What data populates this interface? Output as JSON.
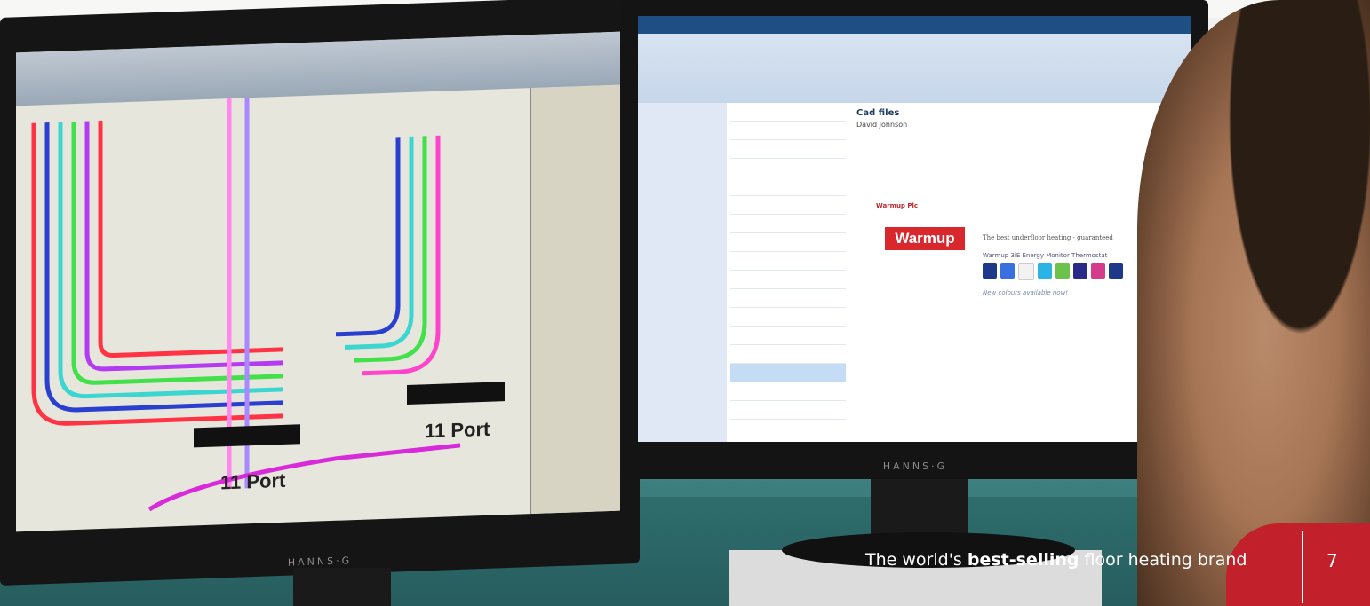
{
  "left_screen": {
    "port_label_left": "11 Port",
    "port_label_right": "11 Port"
  },
  "right_screen": {
    "email_subject": "Cad files",
    "sender": "David Johnson",
    "company": "Warmup Plc",
    "logo_text": "Warmup",
    "tagline": "The best underfloor heating - guaranteed",
    "product": "Warmup 3iE Energy Monitor Thermostat",
    "colours_note": "New colours available now!"
  },
  "monitor_brand": "HANNS·G",
  "caption": {
    "prefix": "The world's ",
    "bold": "best-selling",
    "suffix": " floor heating brand"
  },
  "page_number": "7",
  "colors": {
    "accent_red": "#d9272e",
    "desk_teal": "#2f6d6d"
  }
}
